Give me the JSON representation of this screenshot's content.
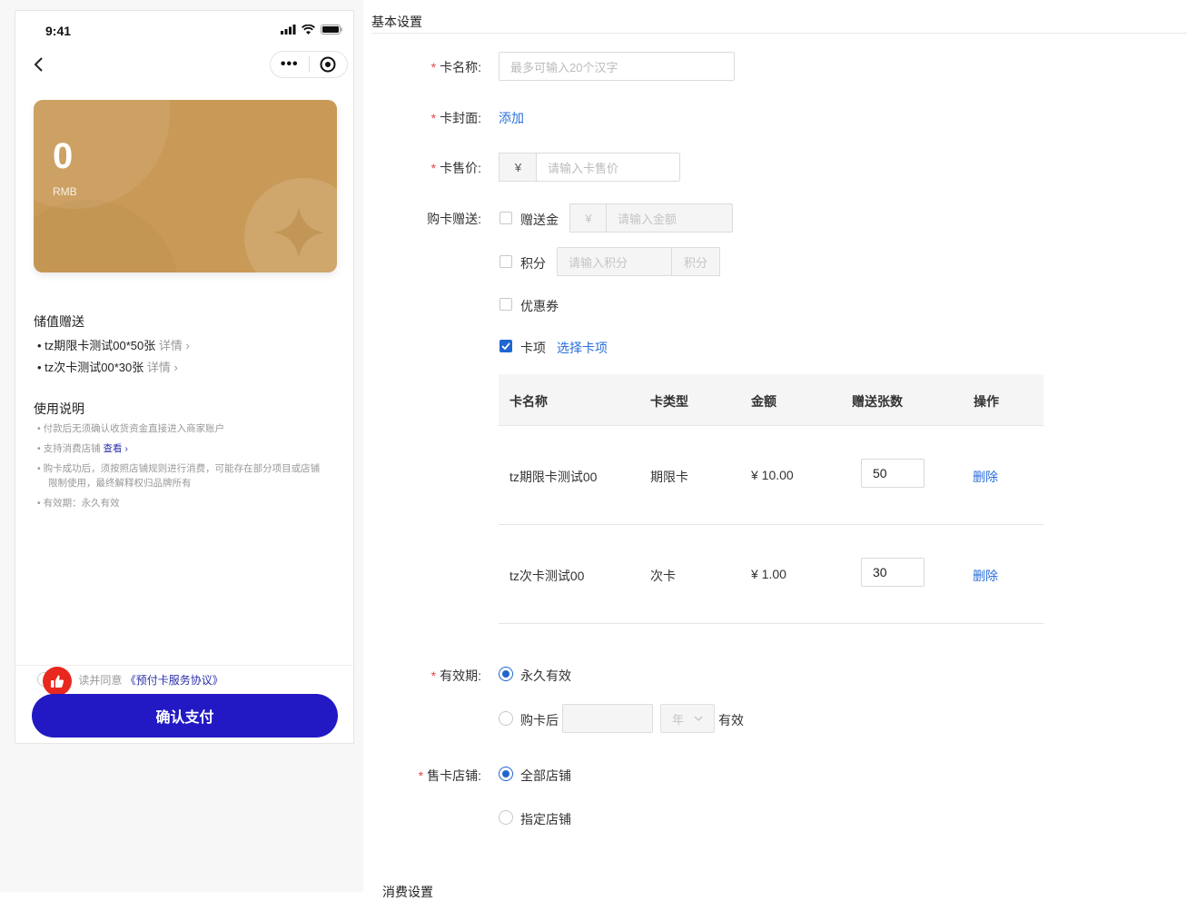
{
  "preview": {
    "status_time": "9:41",
    "card": {
      "amount": "0",
      "unit": "RMB",
      "color": "#c99a57"
    },
    "gift_section_title": "储值赠送",
    "gift_items": [
      {
        "text": "tz期限卡测试00*50张",
        "more": "详情"
      },
      {
        "text": "tz次卡测试00*30张",
        "more": "详情"
      }
    ],
    "usage_title": "使用说明",
    "usage_notes": [
      {
        "text": "付款后无须确认收货资金直接进入商家账户"
      },
      {
        "text": "支持消费店铺",
        "link": "查看"
      },
      {
        "text": "购卡成功后，须按照店铺规则进行消费，可能存在部分项目或店铺限制使用，最终解释权归品牌所有"
      },
      {
        "text": "有效期：永久有效"
      }
    ],
    "agree_prefix": "读并同意",
    "agree_link": "《预付卡服务协议》",
    "pay_button": "确认支付",
    "pay_color": "#2219c4"
  },
  "form": {
    "section_title": "基本设置",
    "card_name": {
      "label": "卡名称:",
      "placeholder": "最多可输入20个汉字"
    },
    "card_cover": {
      "label": "卡封面:",
      "action": "添加"
    },
    "card_price": {
      "label": "卡售价:",
      "currency": "¥",
      "placeholder": "请输入卡售价"
    },
    "gift": {
      "label": "购卡赠送:",
      "gift_money": {
        "label": "赠送金",
        "currency": "¥",
        "placeholder": "请输入金额",
        "checked": false
      },
      "points": {
        "label": "积分",
        "placeholder": "请输入积分",
        "suffix": "积分",
        "checked": false
      },
      "coupon": {
        "label": "优惠券",
        "checked": false
      },
      "card_item": {
        "label": "卡项",
        "action": "选择卡项",
        "checked": true
      }
    },
    "table": {
      "headers": [
        "卡名称",
        "卡类型",
        "金额",
        "赠送张数",
        "操作"
      ],
      "rows": [
        {
          "name": "tz期限卡测试00",
          "type": "期限卡",
          "amount": "¥ 10.00",
          "qty": "50",
          "action": "删除"
        },
        {
          "name": "tz次卡测试00",
          "type": "次卡",
          "amount": "¥ 1.00",
          "qty": "30",
          "action": "删除"
        }
      ]
    },
    "validity": {
      "label": "有效期:",
      "option_forever": "永久有效",
      "option_after": "购卡后",
      "unit": "年",
      "suffix": "有效",
      "selected": "forever"
    },
    "stores": {
      "label": "售卡店铺:",
      "option_all": "全部店铺",
      "option_specific": "指定店铺",
      "selected": "all"
    },
    "next_section_title": "消费设置",
    "accent_color": "#1f66d1",
    "required_color": "#e54545"
  }
}
